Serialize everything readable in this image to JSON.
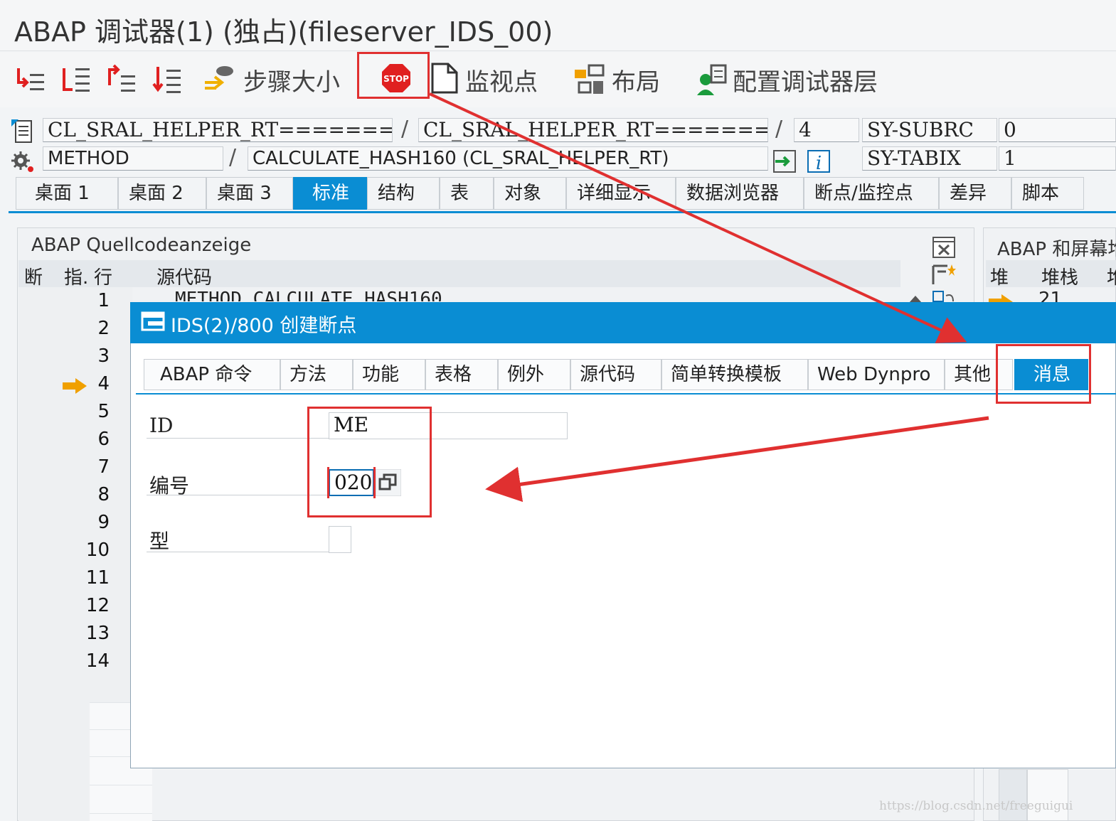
{
  "window": {
    "title": "ABAP 调试器(1)  (独占)(fileserver_IDS_00)"
  },
  "toolbar": {
    "step_size_label": "步骤大小",
    "stop_label": "STOP",
    "watchpoint_label": "监视点",
    "layout_label": "布局",
    "config_label": "配置调试器层"
  },
  "info": {
    "program1": "CL_SRAL_HELPER_RT============",
    "program2": "CL_SRAL_HELPER_RT============",
    "line": "4",
    "sy_subrc_label": "SY-SUBRC",
    "sy_subrc_value": "0",
    "type": "METHOD",
    "event": "CALCULATE_HASH160 (CL_SRAL_HELPER_RT)",
    "sy_tabix_label": "SY-TABIX",
    "sy_tabix_value": "1"
  },
  "main_tabs": [
    "桌面 1",
    "桌面 2",
    "桌面 3",
    "标准",
    "结构",
    "表",
    "对象",
    "详细显示",
    "数据浏览器",
    "断点/监控点",
    "差异",
    "脚本"
  ],
  "source": {
    "title": "ABAP Quellcodeanzeige",
    "col_break": "断",
    "col_pointer": "指.",
    "col_line": "行",
    "col_source": "源代码",
    "first_line": "METHOD CALCULATE_HASH160.",
    "line_numbers": [
      "1",
      "2",
      "3",
      "4",
      "5",
      "6",
      "7",
      "8",
      "9",
      "10",
      "11",
      "12",
      "13",
      "14"
    ]
  },
  "stack": {
    "title": "ABAP 和屏幕堆",
    "col1": "堆",
    "col2": "堆栈",
    "col3": "堆",
    "row1": "21"
  },
  "dialog": {
    "title": "IDS(2)/800 创建断点",
    "tabs": [
      "ABAP 命令",
      "方法",
      "功能",
      "表格",
      "例外",
      "源代码",
      "简单转换模板",
      "Web Dynpro",
      "其他",
      "消息"
    ],
    "id_label": "ID",
    "id_value": "ME",
    "number_label": "编号",
    "number_value": "020",
    "type_label": "型",
    "type_value": ""
  },
  "watermark": "https://blog.csdn.net/freeguigui",
  "colors": {
    "accent": "#0a8dd3",
    "annotation": "#e03030",
    "arrow": "#f0a000"
  }
}
